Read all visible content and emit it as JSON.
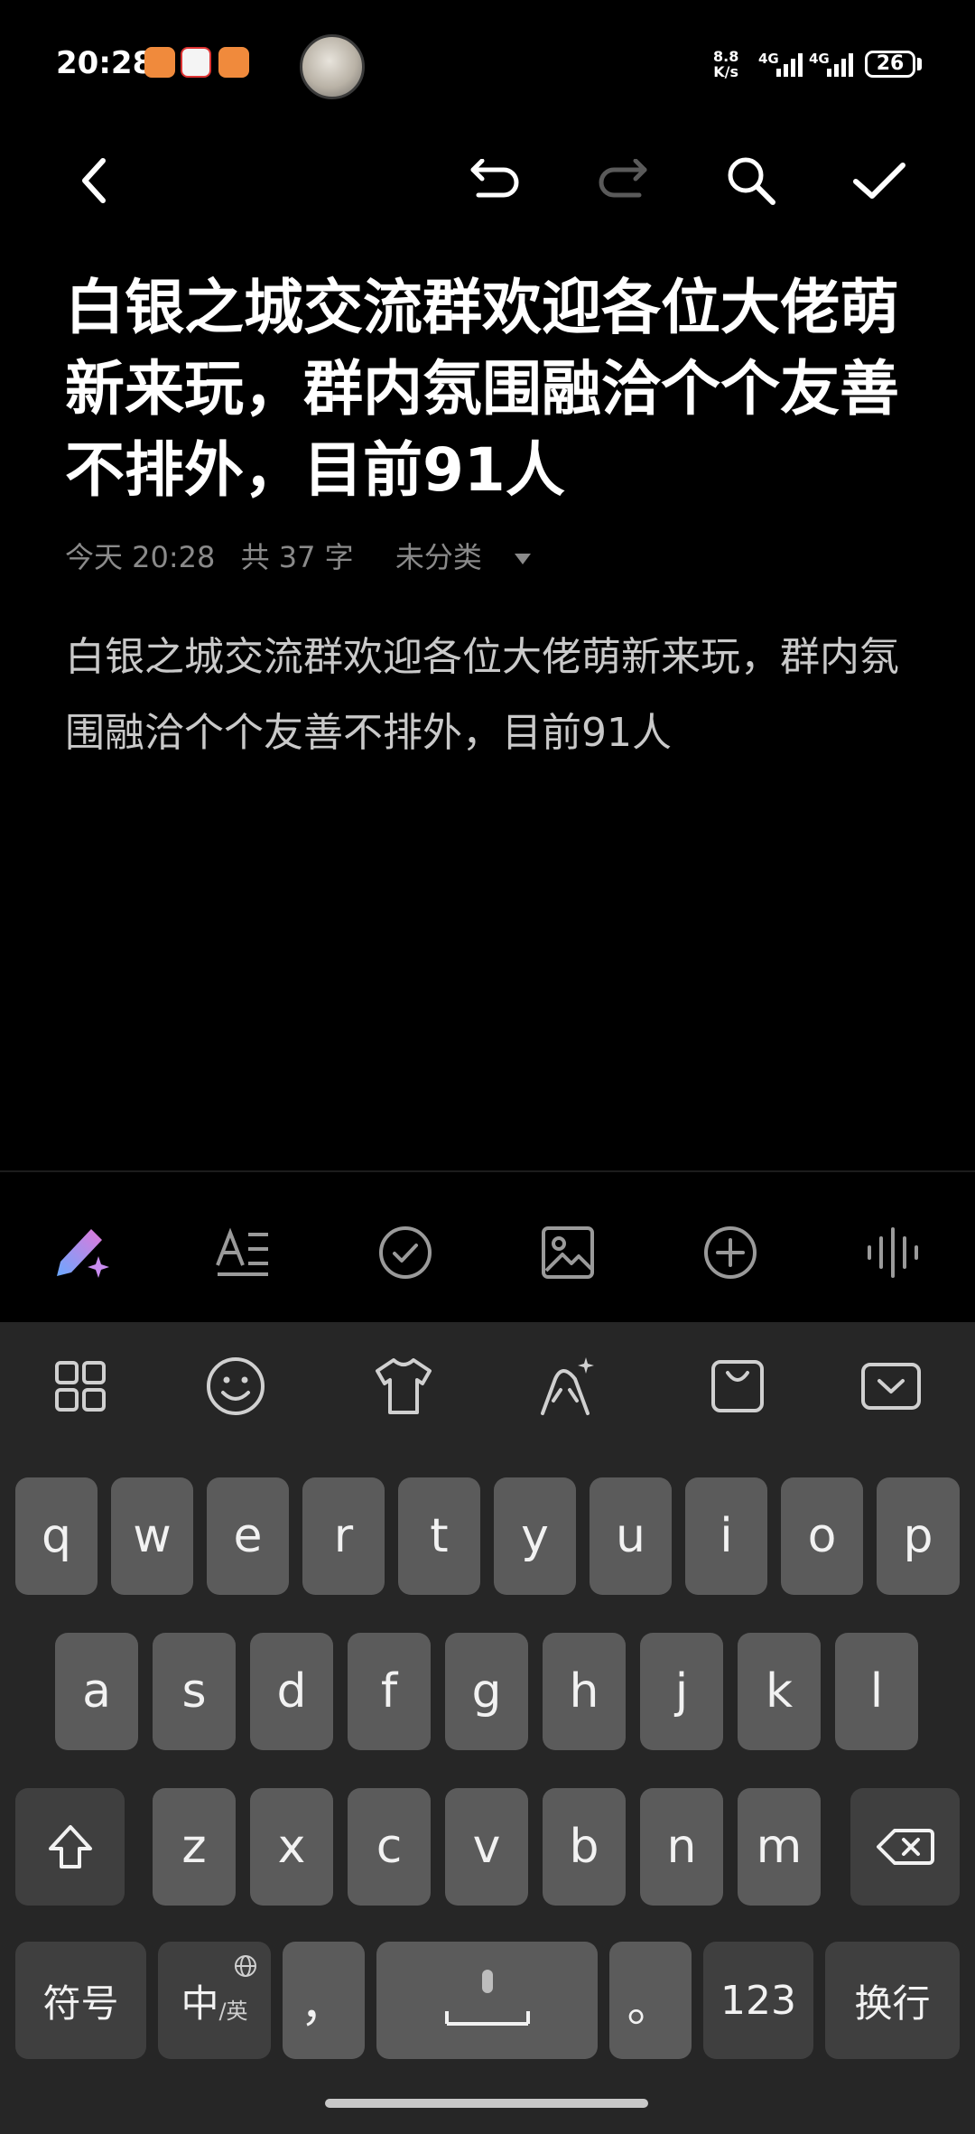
{
  "status_bar": {
    "time": "20:28",
    "net_speed_value": "8.8",
    "net_speed_unit": "K/s",
    "signal_1": "4G",
    "signal_2": "4G",
    "battery": "26"
  },
  "note": {
    "title": "白银之城交流群欢迎各位大佬萌新来玩，群内氛围融洽个个友善不排外，目前91人",
    "meta_date": "今天 20:28",
    "meta_count": "共 37 字",
    "category": "未分类",
    "body": "白银之城交流群欢迎各位大佬萌新来玩，群内氛围融洽个个友善不排外，目前91人"
  },
  "keyboard": {
    "row1": [
      "q",
      "w",
      "e",
      "r",
      "t",
      "y",
      "u",
      "i",
      "o",
      "p"
    ],
    "row2": [
      "a",
      "s",
      "d",
      "f",
      "g",
      "h",
      "j",
      "k",
      "l"
    ],
    "row3": [
      "z",
      "x",
      "c",
      "v",
      "b",
      "n",
      "m"
    ],
    "symbols_label": "符号",
    "lang_main": "中",
    "lang_alt": "/英",
    "comma": "，",
    "period": "。",
    "numbers_label": "123",
    "enter_label": "换行"
  },
  "colors": {
    "background": "#000000",
    "keyboard_bg": "#262626",
    "key_bg": "#5b5b5b",
    "key_dark_bg": "#3f3f3f",
    "meta_text": "#8a8a8a",
    "body_text": "#c9c9c9"
  }
}
